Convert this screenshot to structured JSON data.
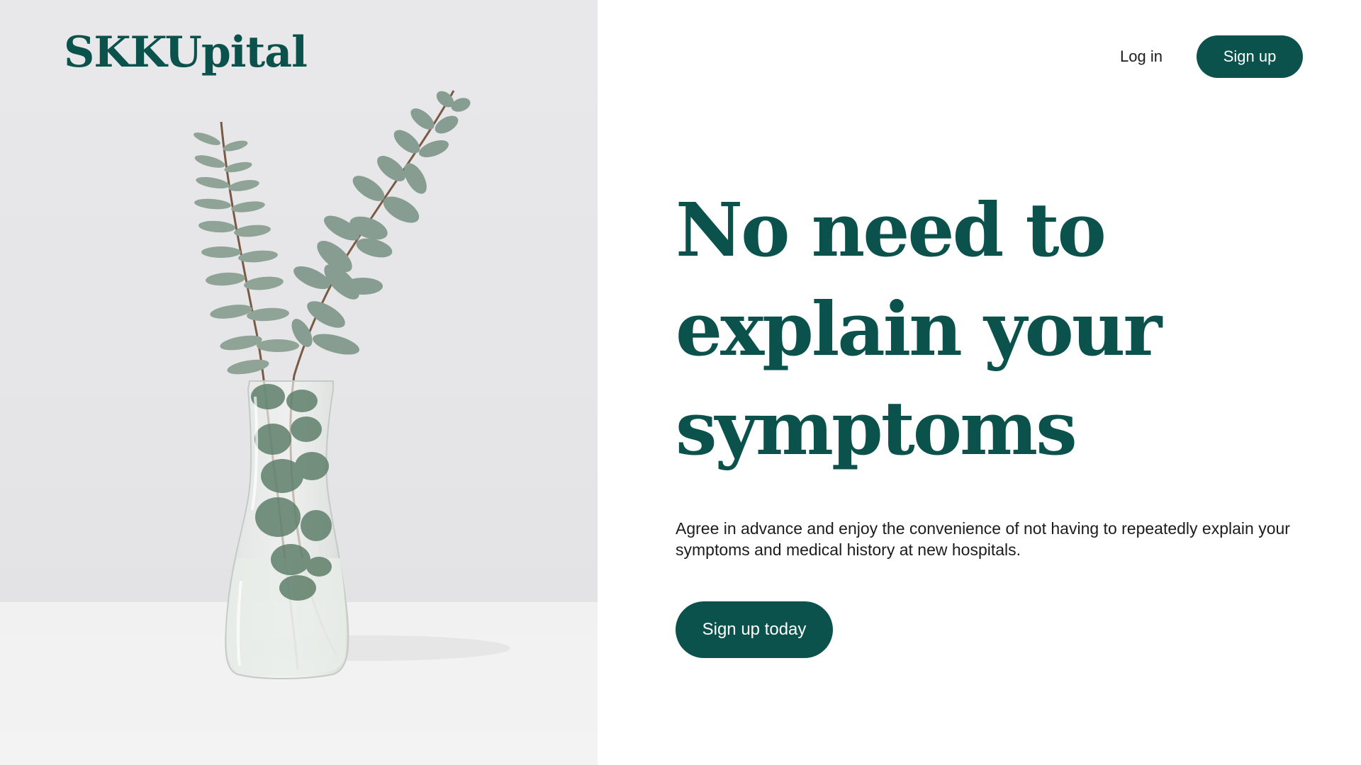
{
  "brand": {
    "name": "SKKUpital",
    "primary_color": "#0b524d"
  },
  "nav": {
    "login_label": "Log in",
    "signup_label": "Sign up"
  },
  "hero": {
    "image_subject": "eucalyptus-in-glass-vase",
    "headline": "No need to explain your symptoms",
    "description": "Agree in advance and enjoy the convenience of not having to repeatedly explain your symptoms and medical history at new hospitals.",
    "cta_label": "Sign up today"
  }
}
